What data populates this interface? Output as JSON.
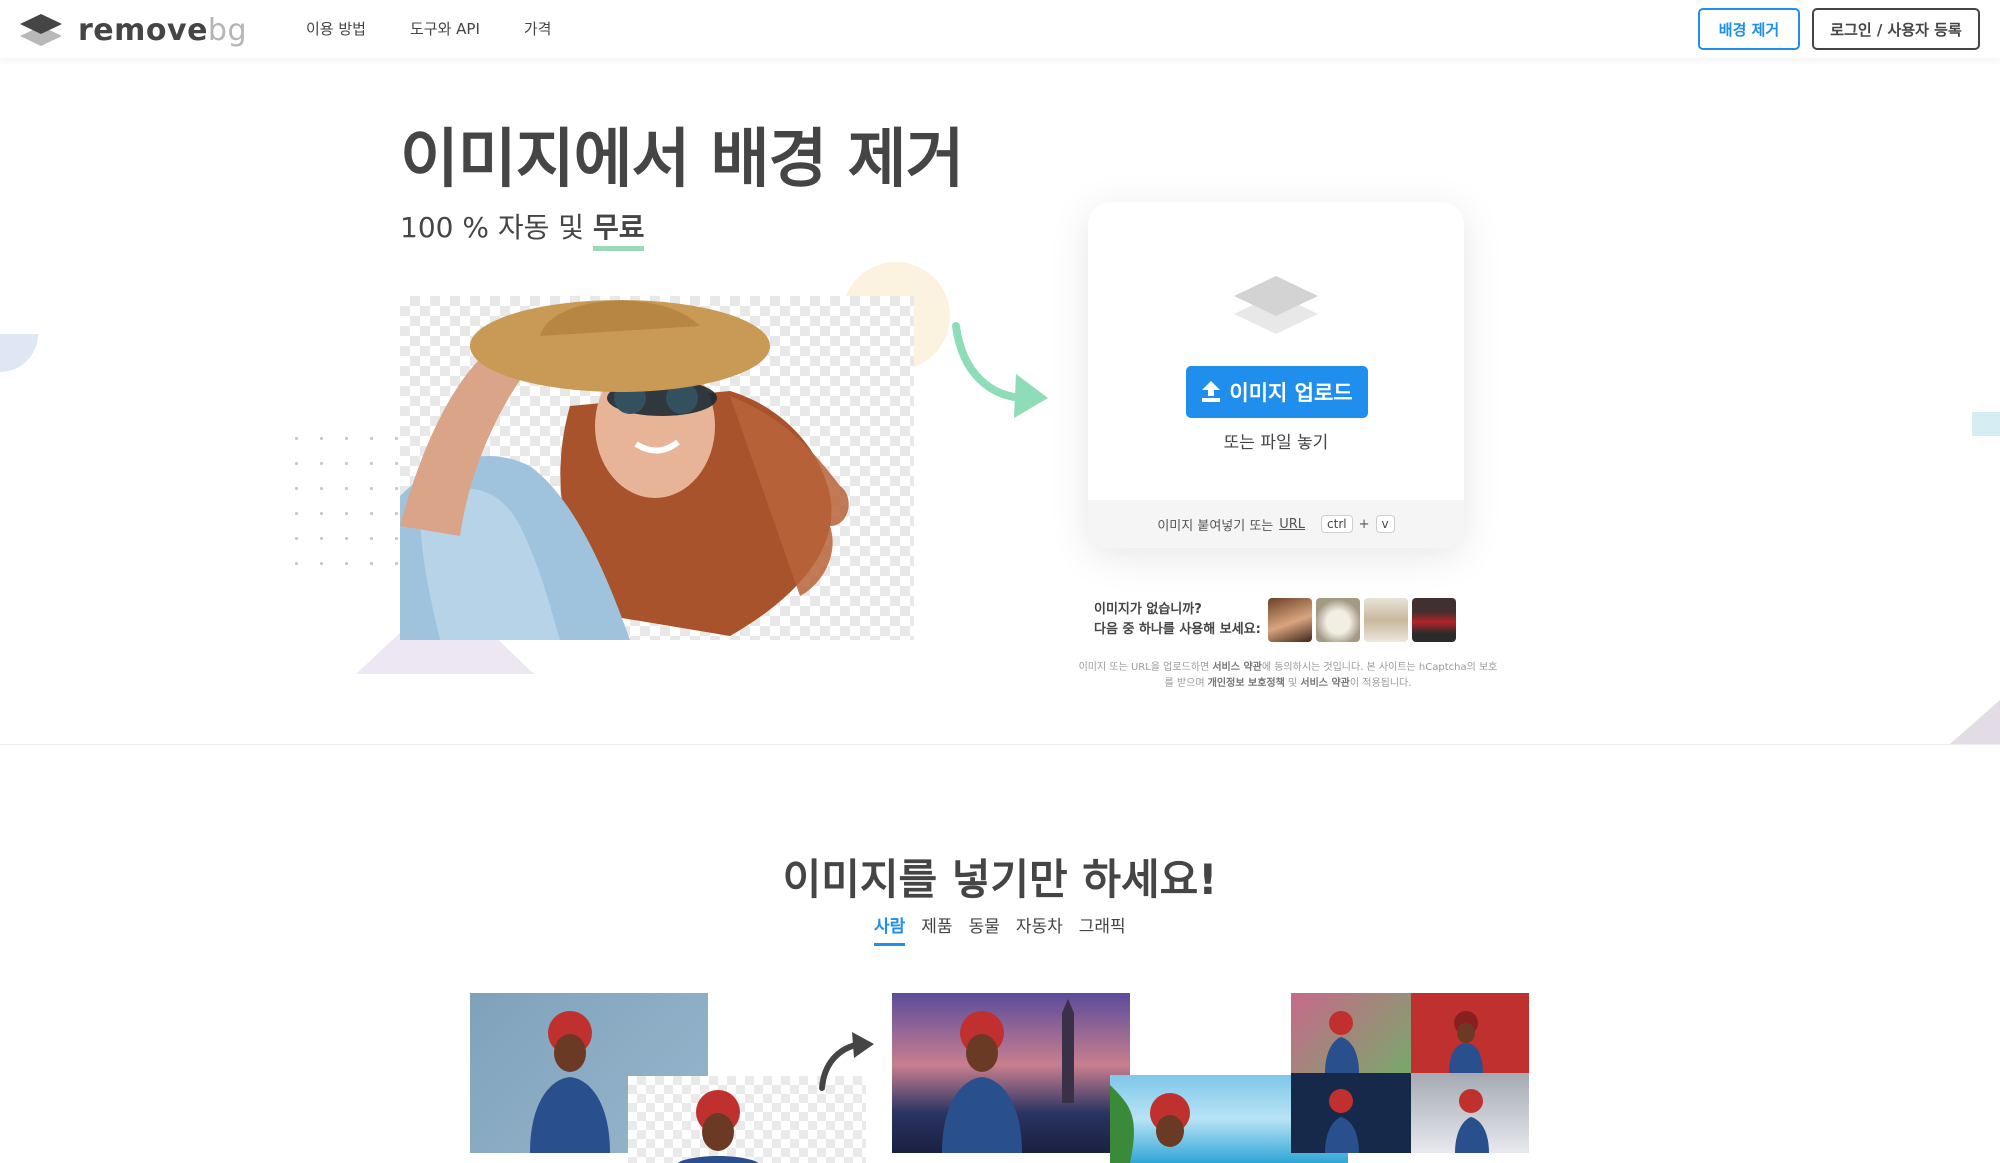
{
  "header": {
    "logo_main": "remove",
    "logo_accent": "bg",
    "nav": [
      "이용 방법",
      "도구와 API",
      "가격"
    ],
    "btn_remove": "배경 제거",
    "btn_login": "로그인 / 사용자 등록"
  },
  "hero": {
    "title": "이미지에서 배경 제거",
    "subtitle_prefix": "100 % 자동 및 ",
    "subtitle_highlight": "무료"
  },
  "upload": {
    "button": "이미지 업로드",
    "drop_text": "또는 파일 놓기",
    "paste_text": "이미지 붙여넣기 또는",
    "url_label": "URL",
    "key1": "ctrl",
    "plus": "+",
    "key2": "v"
  },
  "samples": {
    "line1": "이미지가 없습니까?",
    "line2": "다음 중 하나를 사용해 보세요:"
  },
  "legal": {
    "t1": "이미지 또는 URL을 업로드하면 ",
    "b1": "서비스 약관",
    "t2": "에 동의하시는 것입니다. 본 사이트는 hCaptcha의 보호를 받으며 ",
    "b2": "개인정보 보호정책",
    "t3": " 및 ",
    "b3": "서비스 약관",
    "t4": "이 적용됩니다."
  },
  "section2": {
    "title": "이미지를 넣기만 하세요!",
    "tabs": [
      "사람",
      "제품",
      "동물",
      "자동차",
      "그래픽"
    ],
    "active_tab": "사람"
  },
  "colors": {
    "accent": "#1f8eed",
    "text": "#454545",
    "highlight": "#9bd9b9"
  }
}
